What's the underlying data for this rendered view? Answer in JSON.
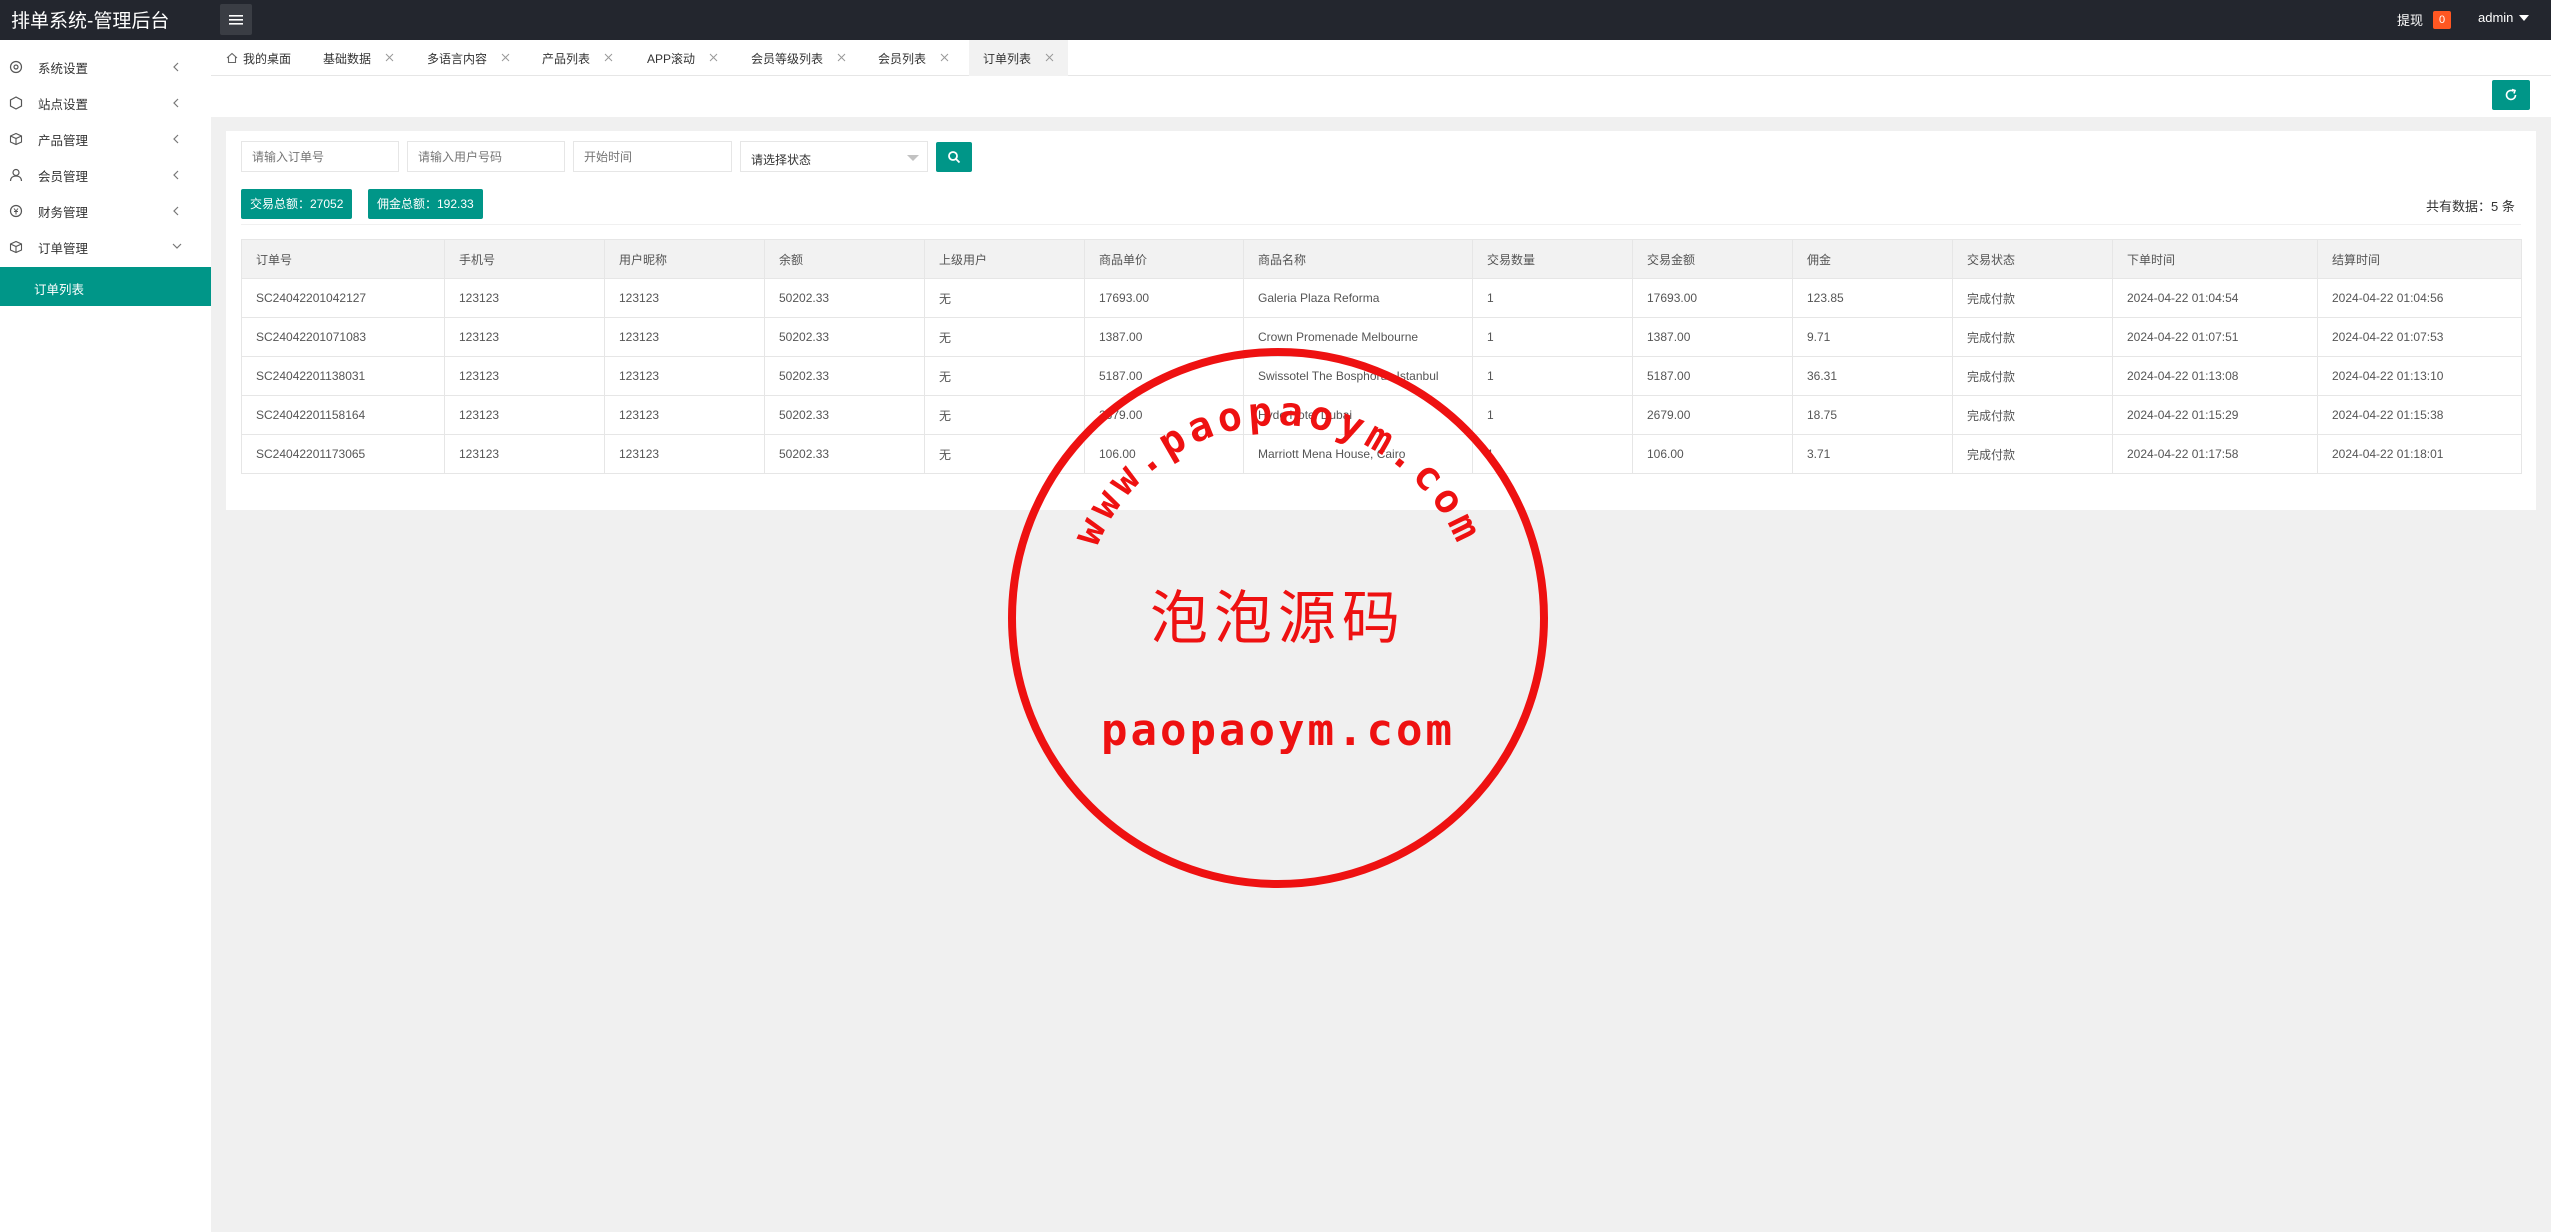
{
  "header": {
    "title": "排单系统-管理后台",
    "withdraw_label": "提现",
    "withdraw_count": "0",
    "user": "admin"
  },
  "sidebar": {
    "items": [
      {
        "label": "系统设置",
        "icon": "gear-icon"
      },
      {
        "label": "站点设置",
        "icon": "site-icon"
      },
      {
        "label": "产品管理",
        "icon": "box-icon"
      },
      {
        "label": "会员管理",
        "icon": "user-icon"
      },
      {
        "label": "财务管理",
        "icon": "money-icon"
      },
      {
        "label": "订单管理",
        "icon": "order-icon"
      }
    ],
    "active_sub": "订单列表"
  },
  "tabs": [
    {
      "label": "我的桌面"
    },
    {
      "label": "基础数据"
    },
    {
      "label": "多语言内容"
    },
    {
      "label": "产品列表"
    },
    {
      "label": "APP滚动"
    },
    {
      "label": "会员等级列表"
    },
    {
      "label": "会员列表"
    },
    {
      "label": "订单列表"
    }
  ],
  "filters": {
    "order_no_placeholder": "请输入订单号",
    "phone_placeholder": "请输入用户号码",
    "start_time_placeholder": "开始时间",
    "status_value": "请选择状态"
  },
  "summary": {
    "trade_total": "交易总额：27052",
    "commission_total": "佣金总额：192.33",
    "count_text": "共有数据：5 条"
  },
  "table": {
    "columns": [
      "订单号",
      "手机号",
      "用户昵称",
      "余额",
      "上级用户",
      "商品单价",
      "商品名称",
      "交易数量",
      "交易金额",
      "佣金",
      "交易状态",
      "下单时间",
      "结算时间"
    ],
    "rows": [
      [
        "SC24042201042127",
        "123123",
        "123123",
        "50202.33",
        "无",
        "17693.00",
        "Galeria Plaza Reforma",
        "1",
        "17693.00",
        "123.85",
        "完成付款",
        "2024-04-22 01:04:54",
        "2024-04-22 01:04:56"
      ],
      [
        "SC24042201071083",
        "123123",
        "123123",
        "50202.33",
        "无",
        "1387.00",
        "Crown Promenade Melbourne",
        "1",
        "1387.00",
        "9.71",
        "完成付款",
        "2024-04-22 01:07:51",
        "2024-04-22 01:07:53"
      ],
      [
        "SC24042201138031",
        "123123",
        "123123",
        "50202.33",
        "无",
        "5187.00",
        "Swissotel The Bosphorus Istanbul",
        "1",
        "5187.00",
        "36.31",
        "完成付款",
        "2024-04-22 01:13:08",
        "2024-04-22 01:13:10"
      ],
      [
        "SC24042201158164",
        "123123",
        "123123",
        "50202.33",
        "无",
        "2679.00",
        "Hyde Hotel Dubai",
        "1",
        "2679.00",
        "18.75",
        "完成付款",
        "2024-04-22 01:15:29",
        "2024-04-22 01:15:38"
      ],
      [
        "SC24042201173065",
        "123123",
        "123123",
        "50202.33",
        "无",
        "106.00",
        "Marriott Mena House, Cairo",
        "1",
        "106.00",
        "3.71",
        "完成付款",
        "2024-04-22 01:17:58",
        "2024-04-22 01:18:01"
      ]
    ]
  },
  "watermark": {
    "arc_text": "www.paopaoym.com",
    "center_text": "泡泡源码",
    "bottom_text": "paopaoym.com",
    "color": "#ee1111"
  },
  "colors": {
    "accent": "#009688",
    "header_bg": "#23262e",
    "badge": "#ff5722"
  }
}
